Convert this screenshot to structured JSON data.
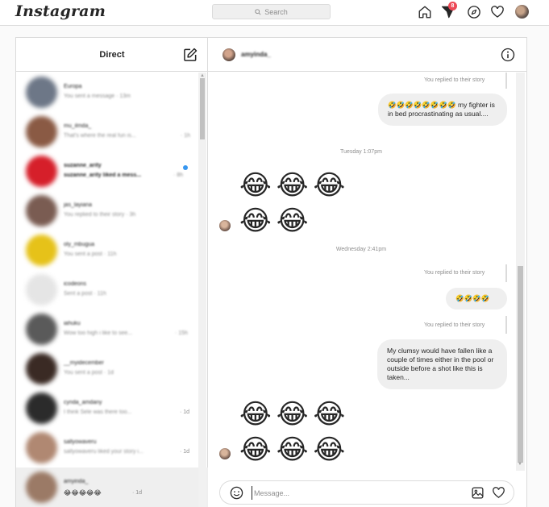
{
  "topbar": {
    "logo": "Instagram",
    "search_placeholder": "Search",
    "dm_badge": "8"
  },
  "left": {
    "title": "Direct",
    "threads": [
      {
        "name": "Europa",
        "preview": "You sent a message · 13m",
        "time": "",
        "avatar": "#6d7787",
        "unread": false
      },
      {
        "name": "mu_ilmda_",
        "preview": "That's where the real fun is...",
        "time": "· 1h",
        "avatar": "#8a5a44",
        "unread": false
      },
      {
        "name": "suzanne_arity",
        "preview": "suzanne_arity liked a mess...",
        "time": "· 8h",
        "avatar": "#d61f2a",
        "unread": true
      },
      {
        "name": "jas_layiana",
        "preview": "You replied to their story · 3h",
        "time": "",
        "avatar": "#7a5c52",
        "unread": false
      },
      {
        "name": "oly_mbugua",
        "preview": "You sent a post · 11h",
        "time": "",
        "avatar": "#e6c219",
        "unread": false
      },
      {
        "name": "icodeons",
        "preview": "Sent a post · 11h",
        "time": "",
        "avatar": "#d9d9d9",
        "unread": false
      },
      {
        "name": "iahuku",
        "preview": "Wow too high i like to see...",
        "time": "· 15h",
        "avatar": "#5a5a5a",
        "unread": false
      },
      {
        "name": "__myidecember",
        "preview": "You sent a post · 1d",
        "time": "",
        "avatar": "#3a2a24",
        "unread": false
      },
      {
        "name": "cynda_amdany",
        "preview": "I think Sele was there too...",
        "time": "· 1d",
        "avatar": "#2b2b2b",
        "unread": false
      },
      {
        "name": "sallyowaveru",
        "preview": "sallyowaveru liked your story i...",
        "time": "· 1d",
        "avatar": "#b08872",
        "unread": false
      },
      {
        "name": "amyinda_",
        "preview": "😂😂😂😂😂",
        "time": "· 1d",
        "avatar": "#9b7a66",
        "unread": false
      }
    ]
  },
  "chat": {
    "contact_name": "amyinda_",
    "reply_label": "You replied to their story",
    "bubble1": "🤣🤣🤣🤣🤣🤣🤣🤣 my fighter is in bed procrastinating as usual....",
    "date1": "Tuesday 1:07pm",
    "emoji_big": "😂",
    "date2": "Wednesday 2:41pm",
    "bubble2": "🤣🤣🤣🤣",
    "bubble3": "My clumsy would have fallen like a couple of times either in the pool or outside before a shot like this is taken...",
    "input_placeholder": "Message..."
  }
}
